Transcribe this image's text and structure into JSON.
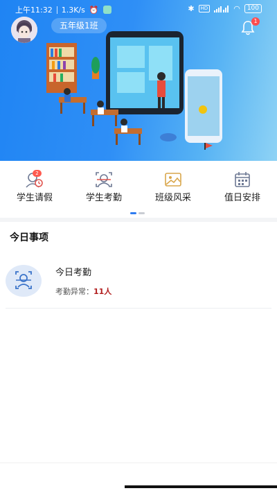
{
  "status_bar": {
    "time": "上午11:32",
    "speed": "1.3K/s",
    "battery": "100"
  },
  "header": {
    "class_name": "五年级1班",
    "notification_count": "1"
  },
  "menu": [
    {
      "label": "学生请假",
      "icon": "leave-request-icon",
      "badge": "2"
    },
    {
      "label": "学生考勤",
      "icon": "attendance-face-icon"
    },
    {
      "label": "班级风采",
      "icon": "gallery-icon"
    },
    {
      "label": "值日安排",
      "icon": "calendar-icon"
    }
  ],
  "today": {
    "section_title": "今日事项",
    "item_title": "今日考勤",
    "item_sub_label": "考勤异常：",
    "item_sub_value": "11人"
  },
  "colors": {
    "accent": "#2f7cf0",
    "hero_start": "#1f84f3",
    "alert": "#b21f1f"
  }
}
